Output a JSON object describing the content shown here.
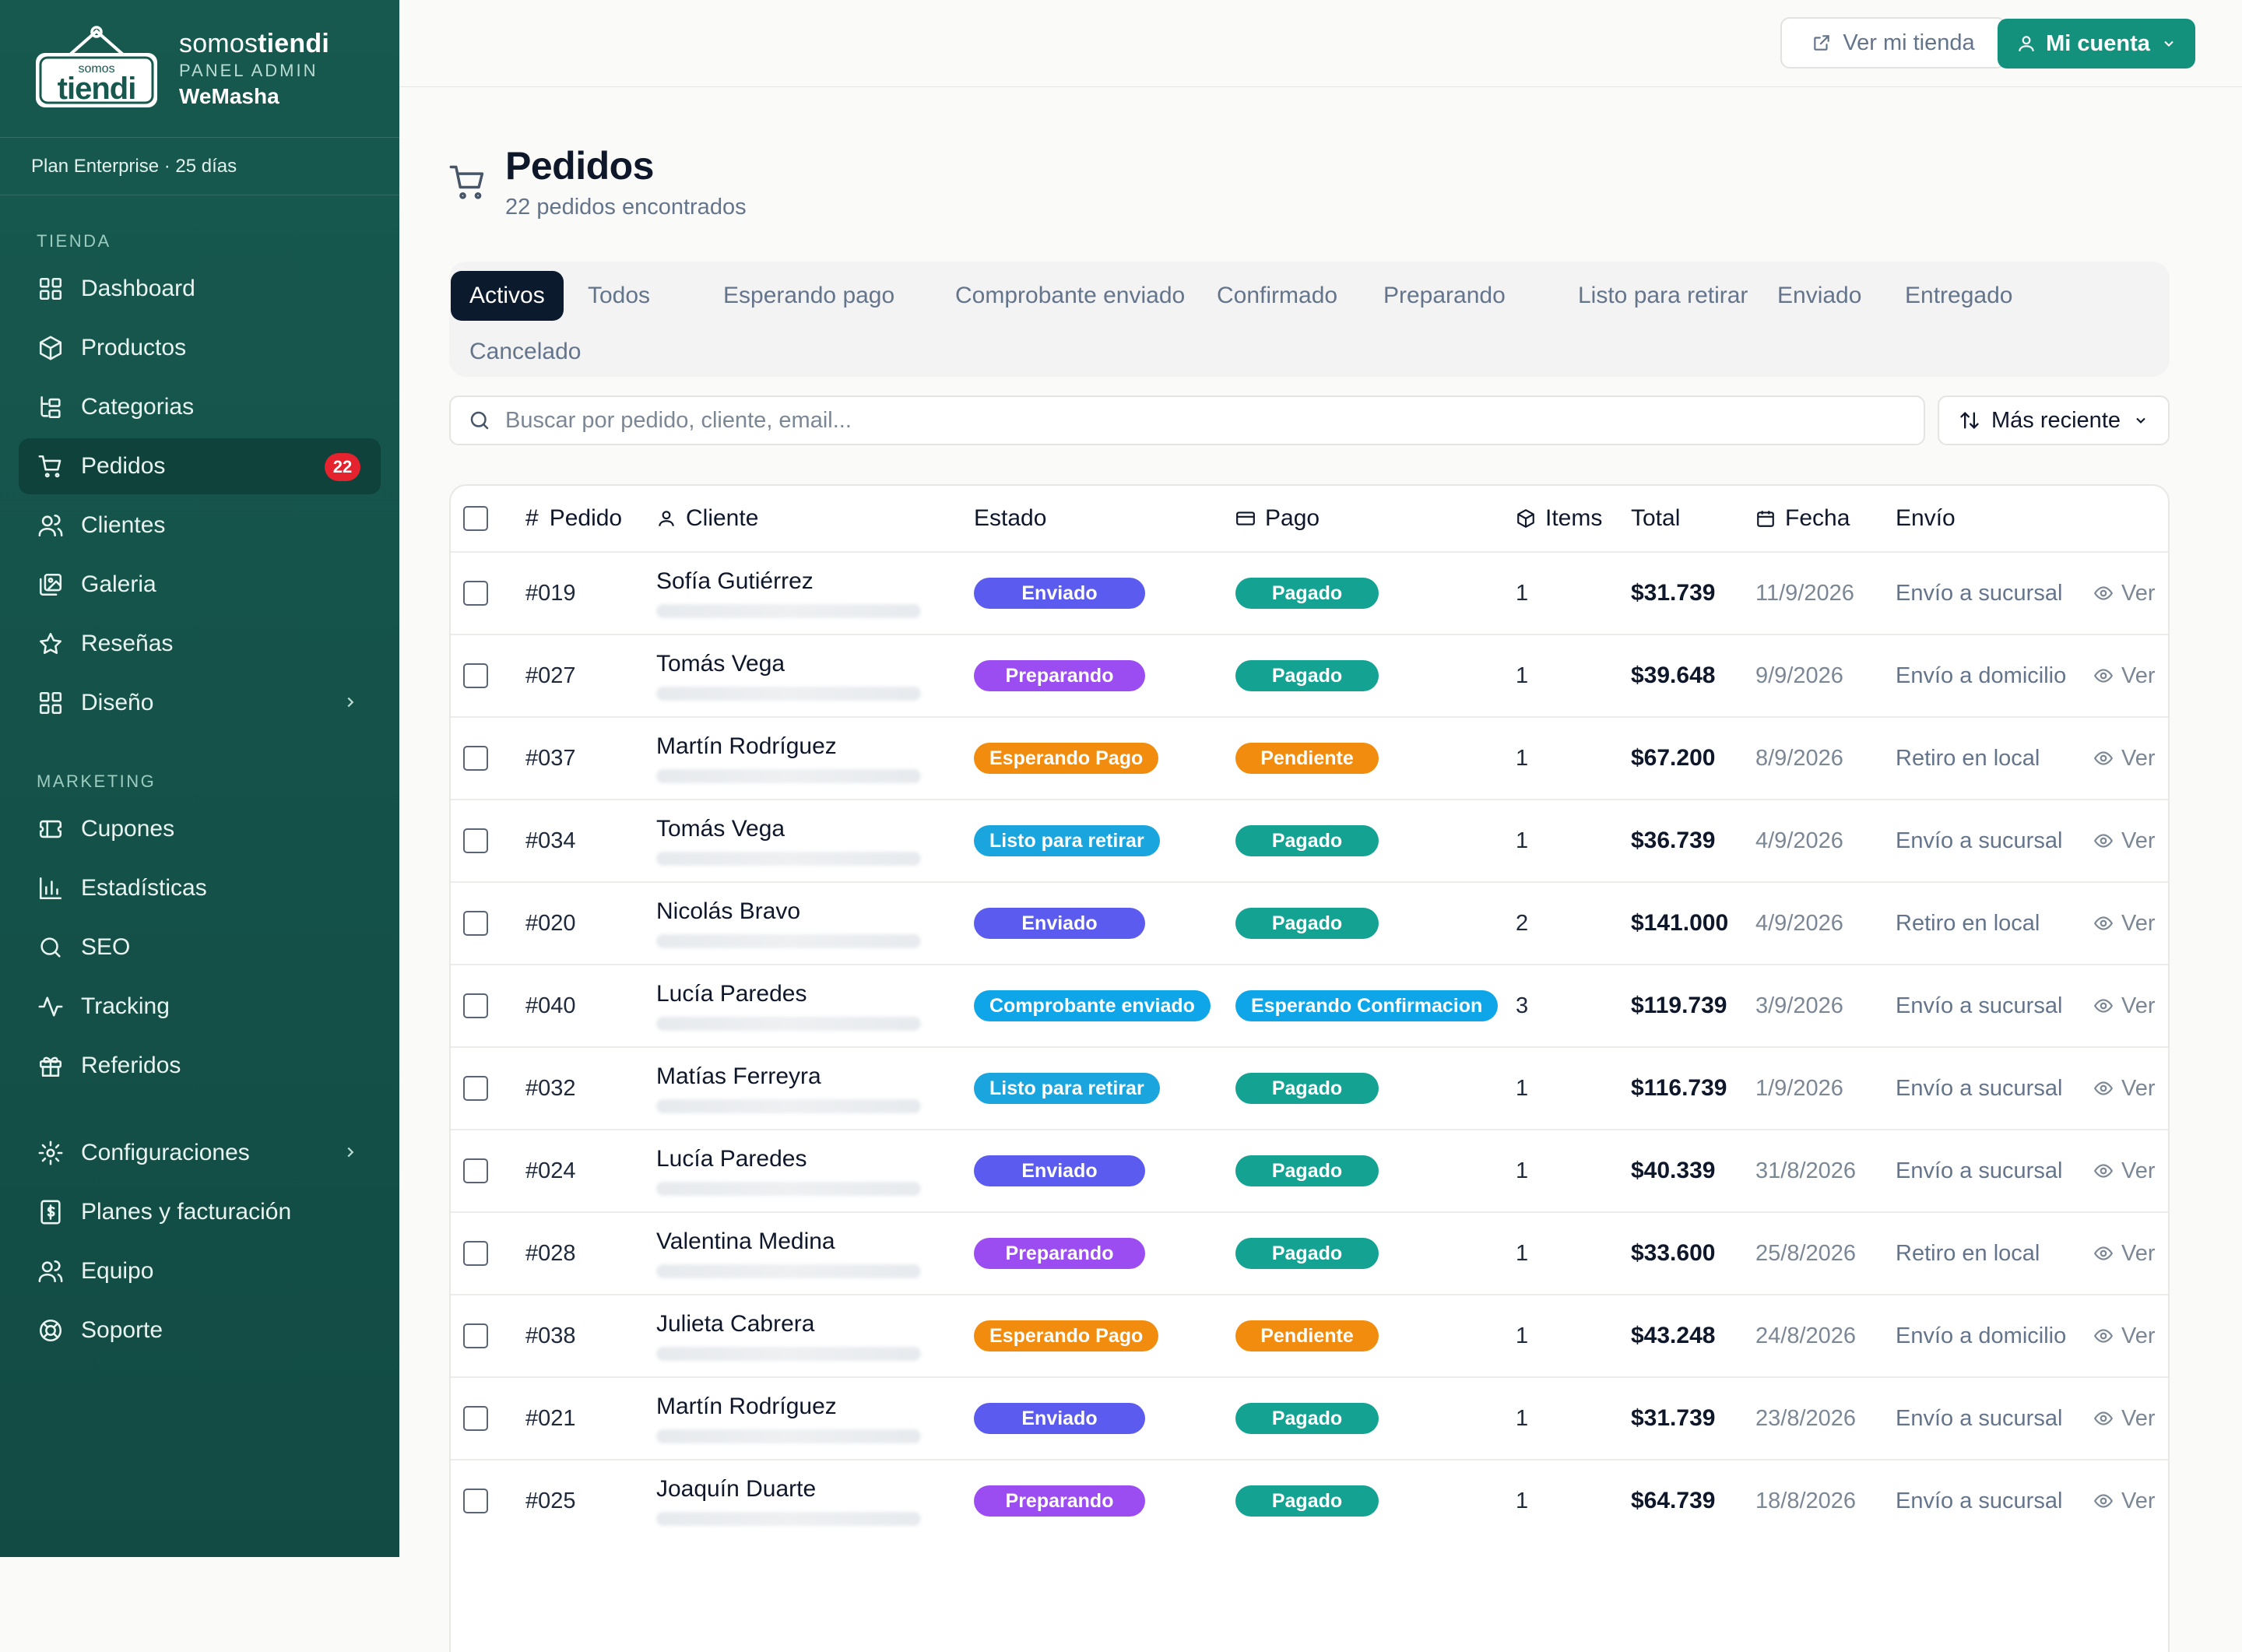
{
  "brand": {
    "name_light": "somos",
    "name_bold": "tiendi",
    "subtitle": "PANEL ADMIN",
    "store": "WeMasha",
    "logo_small": "somos",
    "logo_big": "tiendi"
  },
  "plan": "Plan Enterprise · 25 días",
  "sidebar": {
    "sections": [
      {
        "label": "TIENDA",
        "items": [
          {
            "label": "Dashboard",
            "icon": "grid-icon"
          },
          {
            "label": "Productos",
            "icon": "box-icon"
          },
          {
            "label": "Categorias",
            "icon": "tree-icon"
          },
          {
            "label": "Pedidos",
            "icon": "cart-icon",
            "badge": "22",
            "active": true
          },
          {
            "label": "Clientes",
            "icon": "users-icon"
          },
          {
            "label": "Galeria",
            "icon": "images-icon"
          },
          {
            "label": "Reseñas",
            "icon": "star-icon"
          },
          {
            "label": "Diseño",
            "icon": "layout-icon",
            "chevron": true
          }
        ]
      },
      {
        "label": "MARKETING",
        "items": [
          {
            "label": "Cupones",
            "icon": "ticket-icon"
          },
          {
            "label": "Estadísticas",
            "icon": "bar-chart-icon"
          },
          {
            "label": "SEO",
            "icon": "search-icon"
          },
          {
            "label": "Tracking",
            "icon": "activity-icon"
          },
          {
            "label": "Referidos",
            "icon": "gift-icon"
          }
        ]
      },
      {
        "label": "",
        "items": [
          {
            "label": "Configuraciones",
            "icon": "gear-icon",
            "chevron": true
          },
          {
            "label": "Planes y facturación",
            "icon": "receipt-icon"
          },
          {
            "label": "Equipo",
            "icon": "team-icon"
          },
          {
            "label": "Soporte",
            "icon": "lifebuoy-icon"
          }
        ]
      }
    ]
  },
  "topbar": {
    "view_store": "Ver mi tienda",
    "account": "Mi cuenta"
  },
  "page": {
    "title": "Pedidos",
    "subtitle": "22 pedidos encontrados"
  },
  "tabs": [
    "Activos",
    "Todos",
    "Esperando pago",
    "Comprobante enviado",
    "Confirmado",
    "Preparando",
    "Listo para retirar",
    "Enviado",
    "Entregado",
    "Cancelado"
  ],
  "search": {
    "placeholder": "Buscar por pedido, cliente, email..."
  },
  "sort": {
    "label": "Más reciente"
  },
  "table": {
    "headers": {
      "pedido": "Pedido",
      "cliente": "Cliente",
      "estado": "Estado",
      "pago": "Pago",
      "items": "Items",
      "total": "Total",
      "fecha": "Fecha",
      "envio": "Envío"
    },
    "action": "Ver",
    "rows": [
      {
        "id": "#019",
        "client": "Sofía Gutiérrez",
        "status": "Enviado",
        "payment": "Pagado",
        "items": "1",
        "total": "$31.739",
        "date": "11/9/2026",
        "shipping": "Envío a sucursal"
      },
      {
        "id": "#027",
        "client": "Tomás Vega",
        "status": "Preparando",
        "payment": "Pagado",
        "items": "1",
        "total": "$39.648",
        "date": "9/9/2026",
        "shipping": "Envío a domicilio"
      },
      {
        "id": "#037",
        "client": "Martín Rodríguez",
        "status": "Esperando Pago",
        "payment": "Pendiente",
        "items": "1",
        "total": "$67.200",
        "date": "8/9/2026",
        "shipping": "Retiro en local"
      },
      {
        "id": "#034",
        "client": "Tomás Vega",
        "status": "Listo para retirar",
        "payment": "Pagado",
        "items": "1",
        "total": "$36.739",
        "date": "4/9/2026",
        "shipping": "Envío a sucursal"
      },
      {
        "id": "#020",
        "client": "Nicolás Bravo",
        "status": "Enviado",
        "payment": "Pagado",
        "items": "2",
        "total": "$141.000",
        "date": "4/9/2026",
        "shipping": "Retiro en local"
      },
      {
        "id": "#040",
        "client": "Lucía Paredes",
        "status": "Comprobante enviado",
        "payment": "Esperando Confirmacion",
        "items": "3",
        "total": "$119.739",
        "date": "3/9/2026",
        "shipping": "Envío a sucursal"
      },
      {
        "id": "#032",
        "client": "Matías Ferreyra",
        "status": "Listo para retirar",
        "payment": "Pagado",
        "items": "1",
        "total": "$116.739",
        "date": "1/9/2026",
        "shipping": "Envío a sucursal"
      },
      {
        "id": "#024",
        "client": "Lucía Paredes",
        "status": "Enviado",
        "payment": "Pagado",
        "items": "1",
        "total": "$40.339",
        "date": "31/8/2026",
        "shipping": "Envío a sucursal"
      },
      {
        "id": "#028",
        "client": "Valentina Medina",
        "status": "Preparando",
        "payment": "Pagado",
        "items": "1",
        "total": "$33.600",
        "date": "25/8/2026",
        "shipping": "Retiro en local"
      },
      {
        "id": "#038",
        "client": "Julieta Cabrera",
        "status": "Esperando Pago",
        "payment": "Pendiente",
        "items": "1",
        "total": "$43.248",
        "date": "24/8/2026",
        "shipping": "Envío a domicilio"
      },
      {
        "id": "#021",
        "client": "Martín Rodríguez",
        "status": "Enviado",
        "payment": "Pagado",
        "items": "1",
        "total": "$31.739",
        "date": "23/8/2026",
        "shipping": "Envío a sucursal"
      },
      {
        "id": "#025",
        "client": "Joaquín Duarte",
        "status": "Preparando",
        "payment": "Pagado",
        "items": "1",
        "total": "$64.739",
        "date": "18/8/2026",
        "shipping": "Envío a sucursal"
      }
    ]
  },
  "colors": {
    "sidebar": "#17594f",
    "accent": "#13917d",
    "badge": "#e5232f",
    "Enviado": "#5b5bf0",
    "Preparando": "#9b4df2",
    "Esperando Pago": "#f28c0f",
    "Listo para retirar": "#1aa5de",
    "Comprobante enviado": "#0ea5e9",
    "Pagado": "#14a392",
    "Pendiente": "#f28c0f",
    "Esperando Confirmacion": "#0ea5e9"
  }
}
